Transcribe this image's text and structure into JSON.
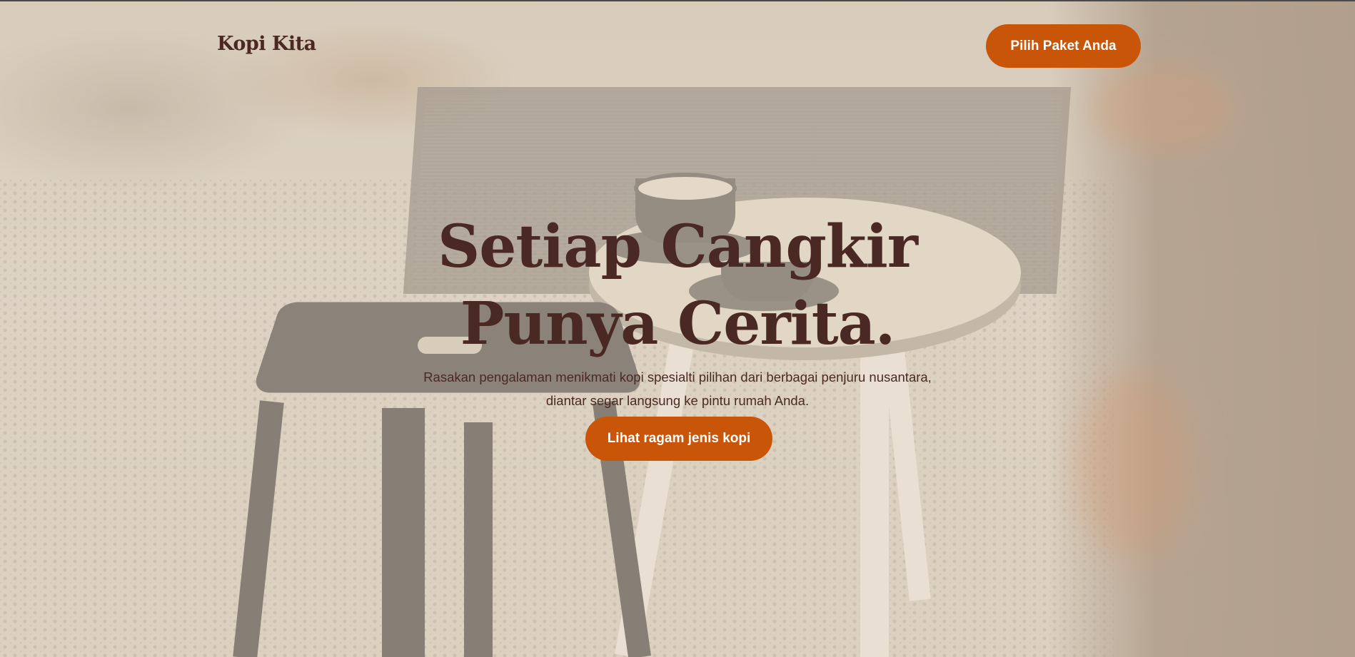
{
  "header": {
    "brand": "Kopi Kita",
    "nav_button": "Pilih Paket Anda"
  },
  "hero": {
    "headline_line1": "Setiap Cangkir",
    "headline_line2": "Punya Cerita.",
    "subtitle_line1": "Rasakan pengalaman menikmati kopi spesialti pilihan dari berbagai penjuru nusantara,",
    "subtitle_line2": "diantar segar langsung ke pintu rumah Anda.",
    "cta_button": "Lihat ragam jenis kopi",
    "background_image": "coffee-cups-on-round-table-with-metal-stool"
  },
  "colors": {
    "accent": "#c85508",
    "text": "#4a2924",
    "button_text": "#ffffff"
  }
}
